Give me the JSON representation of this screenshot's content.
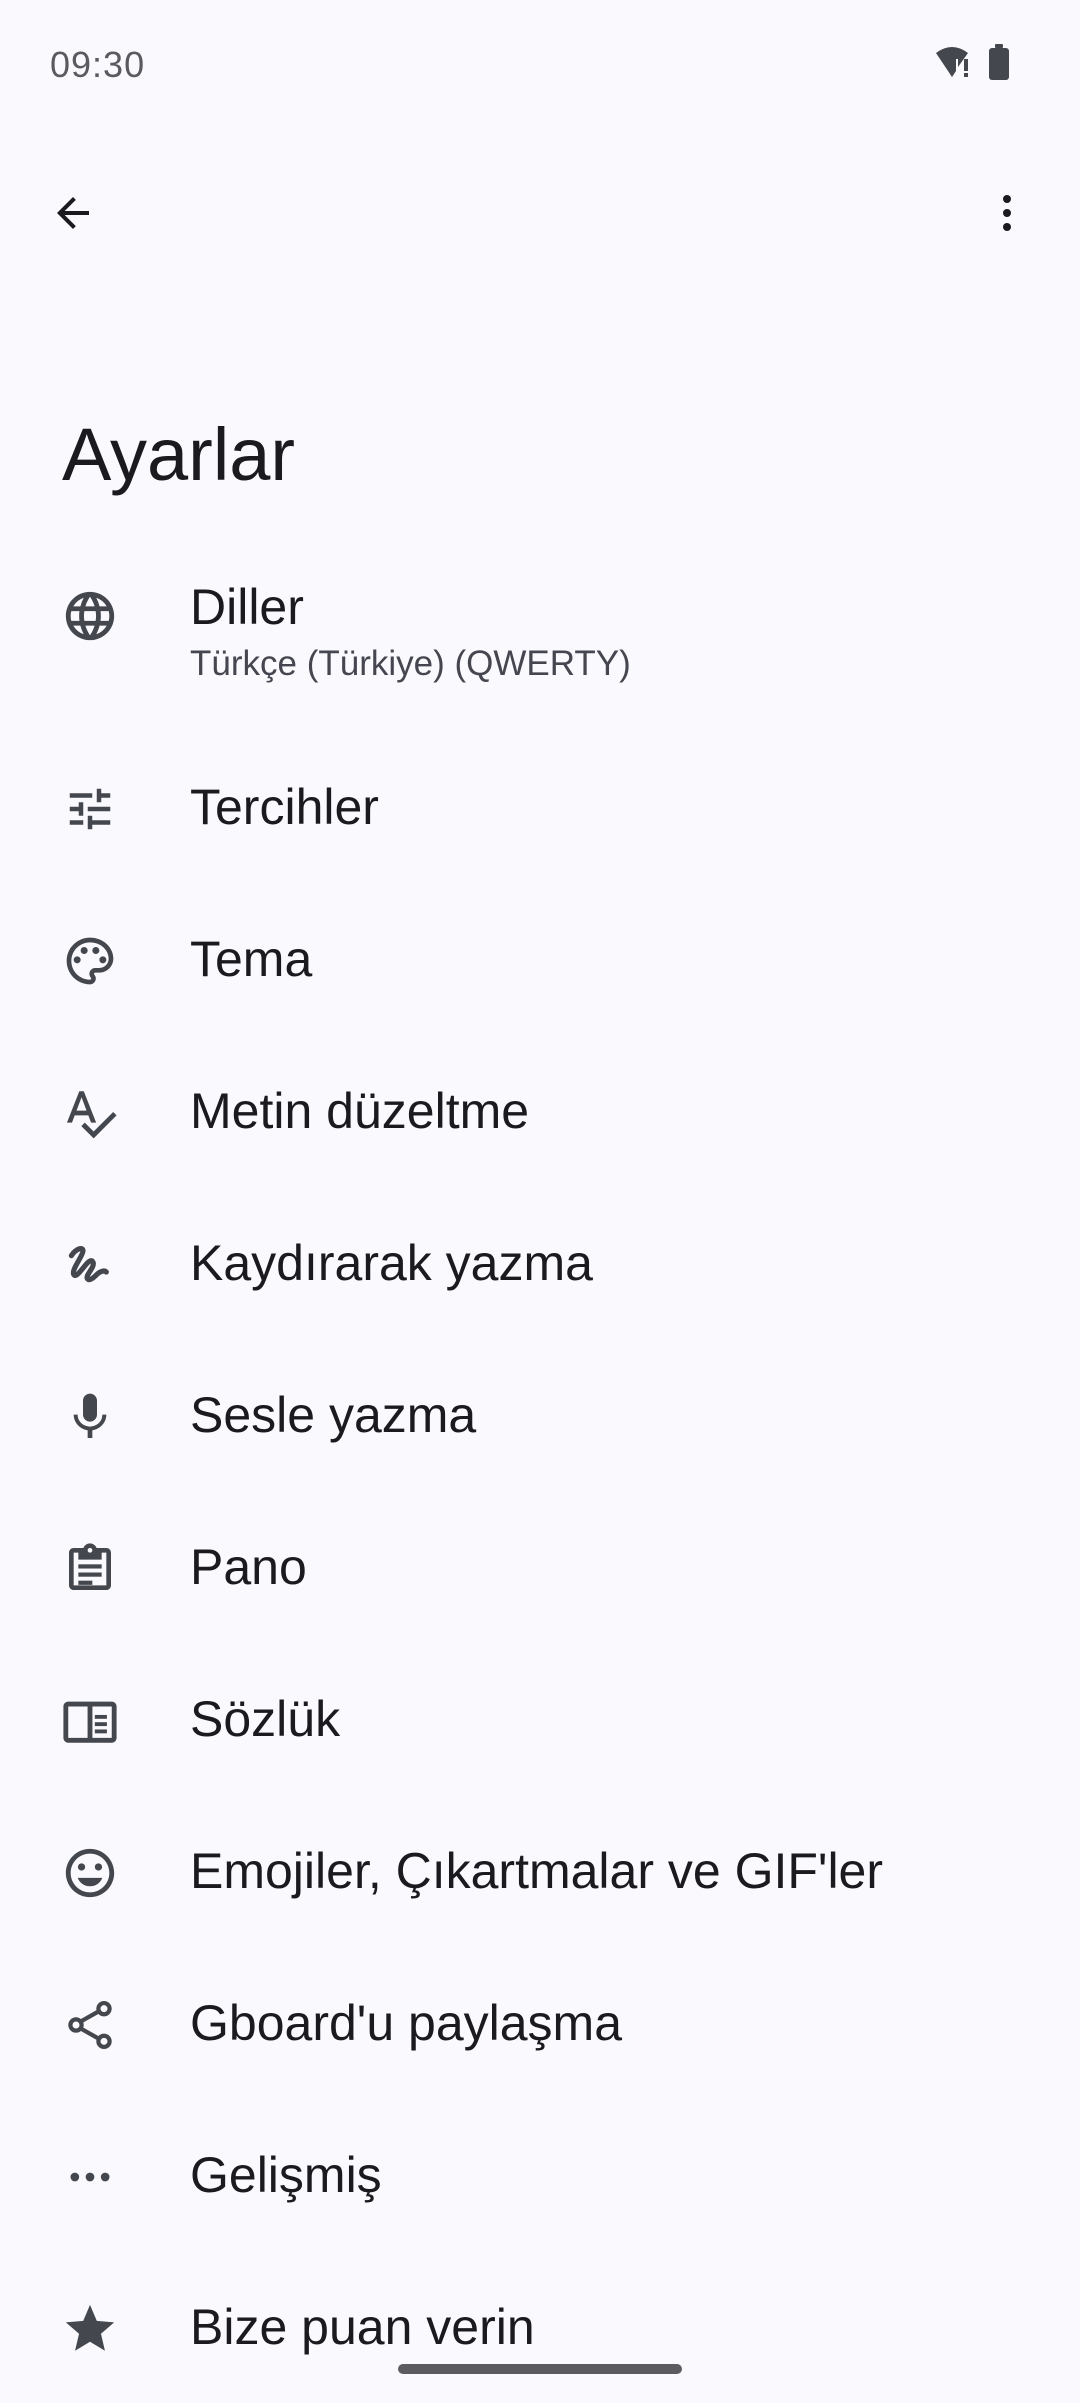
{
  "status_bar": {
    "time": "09:30",
    "icons": [
      "wifi-alert-icon",
      "battery-icon"
    ]
  },
  "toolbar": {
    "back_icon": "arrow-back-icon",
    "menu_icon": "more-vert-icon"
  },
  "page": {
    "title": "Ayarlar"
  },
  "settings": {
    "items": [
      {
        "label": "Diller",
        "subtitle": "Türkçe (Türkiye) (QWERTY)",
        "icon": "globe-icon"
      },
      {
        "label": "Tercihler",
        "icon": "tune-icon"
      },
      {
        "label": "Tema",
        "icon": "palette-icon"
      },
      {
        "label": "Metin düzeltme",
        "icon": "spellcheck-icon"
      },
      {
        "label": "Kaydırarak yazma",
        "icon": "gesture-icon"
      },
      {
        "label": "Sesle yazma",
        "icon": "mic-icon"
      },
      {
        "label": "Pano",
        "icon": "clipboard-icon"
      },
      {
        "label": "Sözlük",
        "icon": "dictionary-icon"
      },
      {
        "label": "Emojiler, Çıkartmalar ve GIF'ler",
        "icon": "emoji-icon"
      },
      {
        "label": "Gboard'u paylaşma",
        "icon": "share-icon"
      },
      {
        "label": "Gelişmiş",
        "icon": "more-horiz-icon"
      },
      {
        "label": "Bize puan verin",
        "icon": "star-icon"
      }
    ]
  },
  "colors": {
    "background": "#f9f9fe",
    "text_primary": "#1b1b1f",
    "text_secondary": "#45464f",
    "icon": "#44474e"
  }
}
